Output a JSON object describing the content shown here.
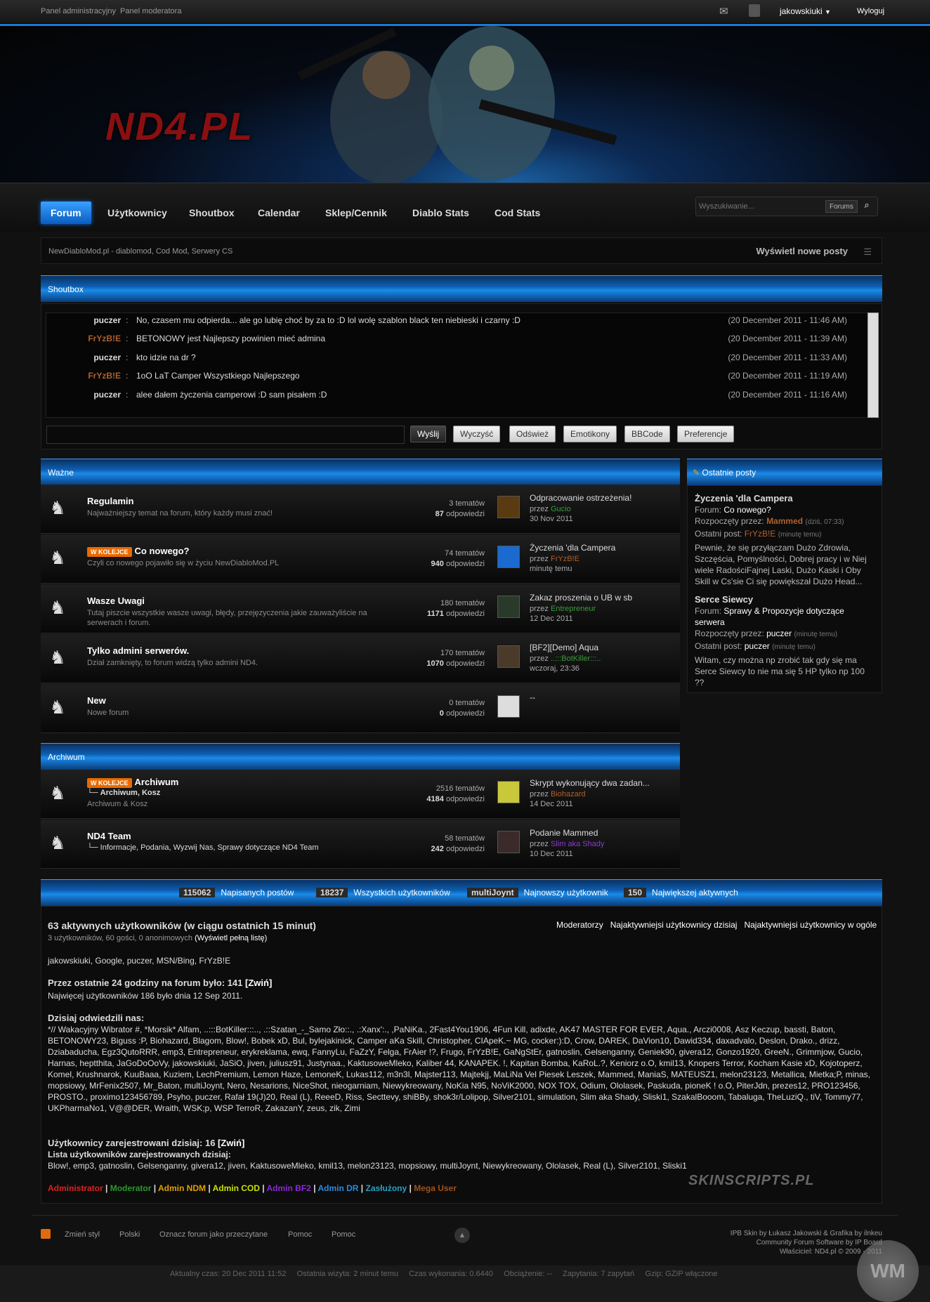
{
  "topbar": {
    "admin_panel": "Panel administracyjny",
    "mod_panel": "Panel moderatora",
    "username": "jakowskiuki",
    "logout": "Wyloguj"
  },
  "header": {
    "logo": "ND4.PL"
  },
  "nav": {
    "items": [
      "Forum",
      "Użytkownicy",
      "Shoutbox",
      "Calendar",
      "Sklep/Cennik",
      "Diablo Stats",
      "Cod Stats"
    ],
    "search_placeholder": "Wyszukiwanie...",
    "search_scope": "Forums"
  },
  "breadcrumb": {
    "text": "NewDiabloMod.pl - diablomod, Cod Mod, Serwery CS",
    "new_posts": "Wyświetl nowe posty"
  },
  "shoutbox": {
    "title": "Shoutbox",
    "rows": [
      {
        "nick": "puczer",
        "nick_color": "#dddddd",
        "msg": "No, czasem mu odpierda... ale go lubię choć by za to :D lol wolę szablon black ten niebieski i czarny :D",
        "time": "(20 December 2011 - 11:46 AM)"
      },
      {
        "nick": "FrYzB!E",
        "nick_color": "#b0602a",
        "msg": "BETONOWY jest Najlepszy powinien mieć admina",
        "time": "(20 December 2011 - 11:39 AM)"
      },
      {
        "nick": "puczer",
        "nick_color": "#dddddd",
        "msg": "kto idzie na dr ?",
        "time": "(20 December 2011 - 11:33 AM)"
      },
      {
        "nick": "FrYzB!E",
        "nick_color": "#b0602a",
        "msg": "1oO LaT Camper  Wszystkiego Najlepszego",
        "time": "(20 December 2011 - 11:19 AM)"
      },
      {
        "nick": "puczer",
        "nick_color": "#dddddd",
        "msg": "alee dałem życzenia camperowi :D sam pisałem :D",
        "time": "(20 December 2011 - 11:16 AM)"
      }
    ],
    "buttons": [
      "Wyślij",
      "Wyczyść",
      "Odśwież",
      "Emotikony",
      "BBCode",
      "Preferencje"
    ]
  },
  "categories": [
    {
      "title": "Ważne",
      "forums": [
        {
          "title": "Regulamin",
          "badge": "",
          "desc": "Najważniejszy temat na forum, który każdy musi znać!",
          "topics": "3",
          "replies": "87",
          "last_title": "Odpracowanie ostrzeżenia!",
          "last_by": "Gucio",
          "last_by_color": "#3a9a3a",
          "last_date": "30 Nov 2011"
        },
        {
          "title": "Co nowego?",
          "badge": "W KOLEJCE",
          "desc": "Czyli co nowego pojawiło się w życiu NewDiabloMod.PL",
          "topics": "74",
          "replies": "940",
          "last_title": "Życzenia 'dla Campera",
          "last_by": "FrYzB!E",
          "last_by_color": "#b0602a",
          "last_date": "minutę temu"
        },
        {
          "title": "Wasze Uwagi",
          "badge": "",
          "desc": "Tutaj piszcie wszystkie wasze uwagi, błędy, przejęzyczenia jakie zauważyliście na serwerach i forum.",
          "topics": "180",
          "replies": "1171",
          "last_title": "Zakaz proszenia o UB w sb",
          "last_by": "Entrepreneur",
          "last_by_color": "#3a9a3a",
          "last_date": "12 Dec 2011"
        },
        {
          "title": "Tylko admini serwerów.",
          "badge": "",
          "desc": "Dział zamknięty, to forum widzą tylko admini ND4.",
          "topics": "170",
          "replies": "1070",
          "last_title": "[BF2][Demo] Aqua",
          "last_by": "..:::BotKiller:::..",
          "last_by_color": "#3a9a3a",
          "last_date": "wczoraj, 23:36"
        },
        {
          "title": "New",
          "badge": "",
          "desc": "Nowe forum",
          "topics": "0",
          "replies": "0",
          "last_title": "--",
          "last_by": "",
          "last_by_color": "#aaaaaa",
          "last_date": ""
        }
      ]
    },
    {
      "title": "Archiwum",
      "forums": [
        {
          "title": "Archiwum",
          "badge": "W KOLEJCE",
          "desc": "Archiwum & Kosz",
          "subforums": "Archiwum,  Kosz",
          "topics": "2516",
          "replies": "4184",
          "last_title": "Skrypt wykonujący dwa zadan...",
          "last_by": "Biohazard",
          "last_by_color": "#b0602a",
          "last_date": "14 Dec 2011"
        },
        {
          "title": "ND4 Team",
          "badge": "",
          "desc": "",
          "subforums": "Informacje,  Podania,  Wyzwij Nas,  Sprawy dotyczące ND4 Team",
          "topics": "58",
          "replies": "242",
          "last_title": "Podanie Mammed",
          "last_by": "Slim aka Shady",
          "last_by_color": "#8a3ad0",
          "last_date": "10 Dec 2011"
        }
      ]
    }
  ],
  "labels": {
    "topics": "tematów",
    "replies": "odpowiedzi",
    "by": "przez"
  },
  "recent_posts": {
    "title": "Ostatnie posty",
    "items": [
      {
        "title": "Życzenia 'dla Campera",
        "forum_label": "Forum:",
        "forum": "Co nowego?",
        "started_label": "Rozpoczęty przez:",
        "started": "Mammed",
        "started_time": "(dziś, 07:33)",
        "last_label": "Ostatni post:",
        "last": "FrYzB!E",
        "last_time": "(minutę temu)",
        "body": "Pewnie, że się przyłączam Dużo Zdrowia, Szczęścia, Pomyślności, Dobrej pracy i w Niej wiele RadościFajnej Laski, Dużo Kaski i Oby Skill w Cs'sie Ci się powiększał Dużo Head..."
      },
      {
        "title": "Serce Siewcy",
        "forum_label": "Forum:",
        "forum": "Sprawy & Propozycje dotyczące serwera",
        "started_label": "Rozpoczęty przez:",
        "started": "puczer",
        "started_time": "(minutę temu)",
        "last_label": "Ostatni post:",
        "last": "puczer",
        "last_time": "(minutę temu)",
        "body": "Witam, czy można np zrobić tak gdy się ma Serce Siewcy to nie ma się 5 HP tylko np 100 ??"
      }
    ]
  },
  "stats": {
    "posts": "115062",
    "posts_label": "Napisanych postów",
    "members": "18237",
    "members_label": "Wszystkich użytkowników",
    "newest": "multiJoynt",
    "newest_label": "Najnowszy użytkownik",
    "max": "150",
    "max_label": "Największej aktywnych"
  },
  "online": {
    "title": "63 aktywnych użytkowników (w ciągu ostatnich 15 minut)",
    "sub": "3 użytkowników, 60 gości, 0 anonimowych",
    "full_list": "(Wyświetl pełną listę)",
    "links": [
      "Moderatorzy",
      "Najaktywniejsi użytkownicy dzisiaj",
      "Najaktywniejsi użytkownicy w ogóle"
    ],
    "users": "jakowskiuki, Google, puczer, MSN/Bing, FrYzB!E",
    "h24": "Przez ostatnie 24 godziny na forum było: 141",
    "collapse": "[Zwiń]",
    "record": "Najwięcej użytkowników 186 było dnia 12 Sep 2011.",
    "today_title": "Dzisiaj odwiedzili nas:",
    "today_list": "*// Wakacyjny Wibrator #, *Morsik* Alfam, ..:::BotKiller:::.., .::Szatan_-_Samo Zło::., .:Xanx':., ,PaNiKa., 2Fast4You1906, 4Fun Kill, adixde, AK47 MASTER FOR EVER, Aqua., Arczi0008, Asz Keczup, bassti, Baton, BETONOWY23, Biguss :P, Biohazard, Blagom, Blow!, Bobek xD, Bul, bylejakinick, Camper aKa Skill, Christopher, CIApeK.~ MG, cocker:):D, Crow, DAREK, DaVion10, Dawid334, daxadvalo, Deslon, Drako., drizz, Dziabaducha, Egz3QutoRRR, emp3, Entrepreneur, erykreklama, ewq, FannyLu, FaZzY, Felga, FrAier !?, Frugo, FrYzB!E, GaNgStEr, gatnoslin, Gelsenganny, Geniek90, givera12, Gonzo1920, GreeN., Grimmjow, Gucio, Harnas, heptthita, JaGoDoOoVy, jakowskiuki, JaSiO, jiven, juliusz91, Justynaa., KaktusoweMleko, Kaliber 44, KANAPEK. !, Kapitan Bomba, KaRoL.?, Keniorz o.O, kmil13, Knopers Terror, Kocham Kasie xD, Kojotoperz, Komel, Krushnarok, KuuBaaa, Kuziem, LechPremium, Lemon Haze, LemoneK, Lukas112, m3n3l, Majster113, Majtekjj, MaLiNa Vel Piesek Leszek, Mammed, ManiaS, MATEUSZ1, melon23123, Metallica, Mietka;P, minas, mopsiowy, MrFenix2507, Mr_Baton, multiJoynt, Nero, Nesarions, NiceShot, nieogarniam, Niewykreowany, NoKia N95, NoViK2000, NOX TOX, Odium, Ololasek, Paskuda, pioneK ! o.O, PiterJdn, prezes12, PRO123456, PROSTO., proximo123456789, Psyho, puczer, Rafał 19(J)20, Real (L), ReeeD, Riss, Secttevy, shiBBy, shok3r/Lolipop, Silver2101, simulation, Slim aka Shady, Sliski1, SzakalBooom, Tabaluga, TheLuziQ., tiV, Tommy77, UKPharmaNo1, V@@DER, Wraith, WSK;p, WSP TerroR, ZakazanY, zeus, zik, Zimi",
    "reg_title": "Użytkownicy zarejestrowani dzisiaj: 16",
    "reg_list_title": "Lista użytkowników zarejestrowanych dzisiaj:",
    "reg_list": "Blow!, emp3, gatnoslin, Gelsenganny, givera12, jiven, KaktusoweMleko, kmil13, melon23123, mopsiowy, multiJoynt, Niewykreowany, Ololasek, Real (L), Silver2101, Sliski1",
    "legend": [
      {
        "label": "Administrator",
        "color": "#e02020"
      },
      {
        "label": "Moderator",
        "color": "#2a9a2a"
      },
      {
        "label": "Admin NDM",
        "color": "#e0a000"
      },
      {
        "label": "Admin COD",
        "color": "#c8e000"
      },
      {
        "label": "Admin BF2",
        "color": "#8a2ad0"
      },
      {
        "label": "Admin DR",
        "color": "#2a8ae0"
      },
      {
        "label": "Zasłużony",
        "color": "#2aa0c0"
      },
      {
        "label": "Mega User",
        "color": "#a0501a"
      }
    ],
    "watermark": "SKINSCRIPTS.PL"
  },
  "footer": {
    "links": [
      "Zmień styl",
      "Polski",
      "Oznacz forum jako przeczytane",
      "Pomoc",
      "Pomoc"
    ],
    "credit1": "IPB Skin by Łukasz Jakowski & Grafika by ilnkeu",
    "credit2": "Community Forum Software by IP Board",
    "credit3": "Właściciel: ND4.pl © 2009 - 2011",
    "status": "Aktualny czas: 20 Dec 2011 11:52     Ostatnia wizyta: 2 minut temu     Czas wykonania: 0.6440     Obciążenie: --     Zapytania: 7 zapytań     Gzip: GZIP włączone",
    "wm": "WM"
  }
}
